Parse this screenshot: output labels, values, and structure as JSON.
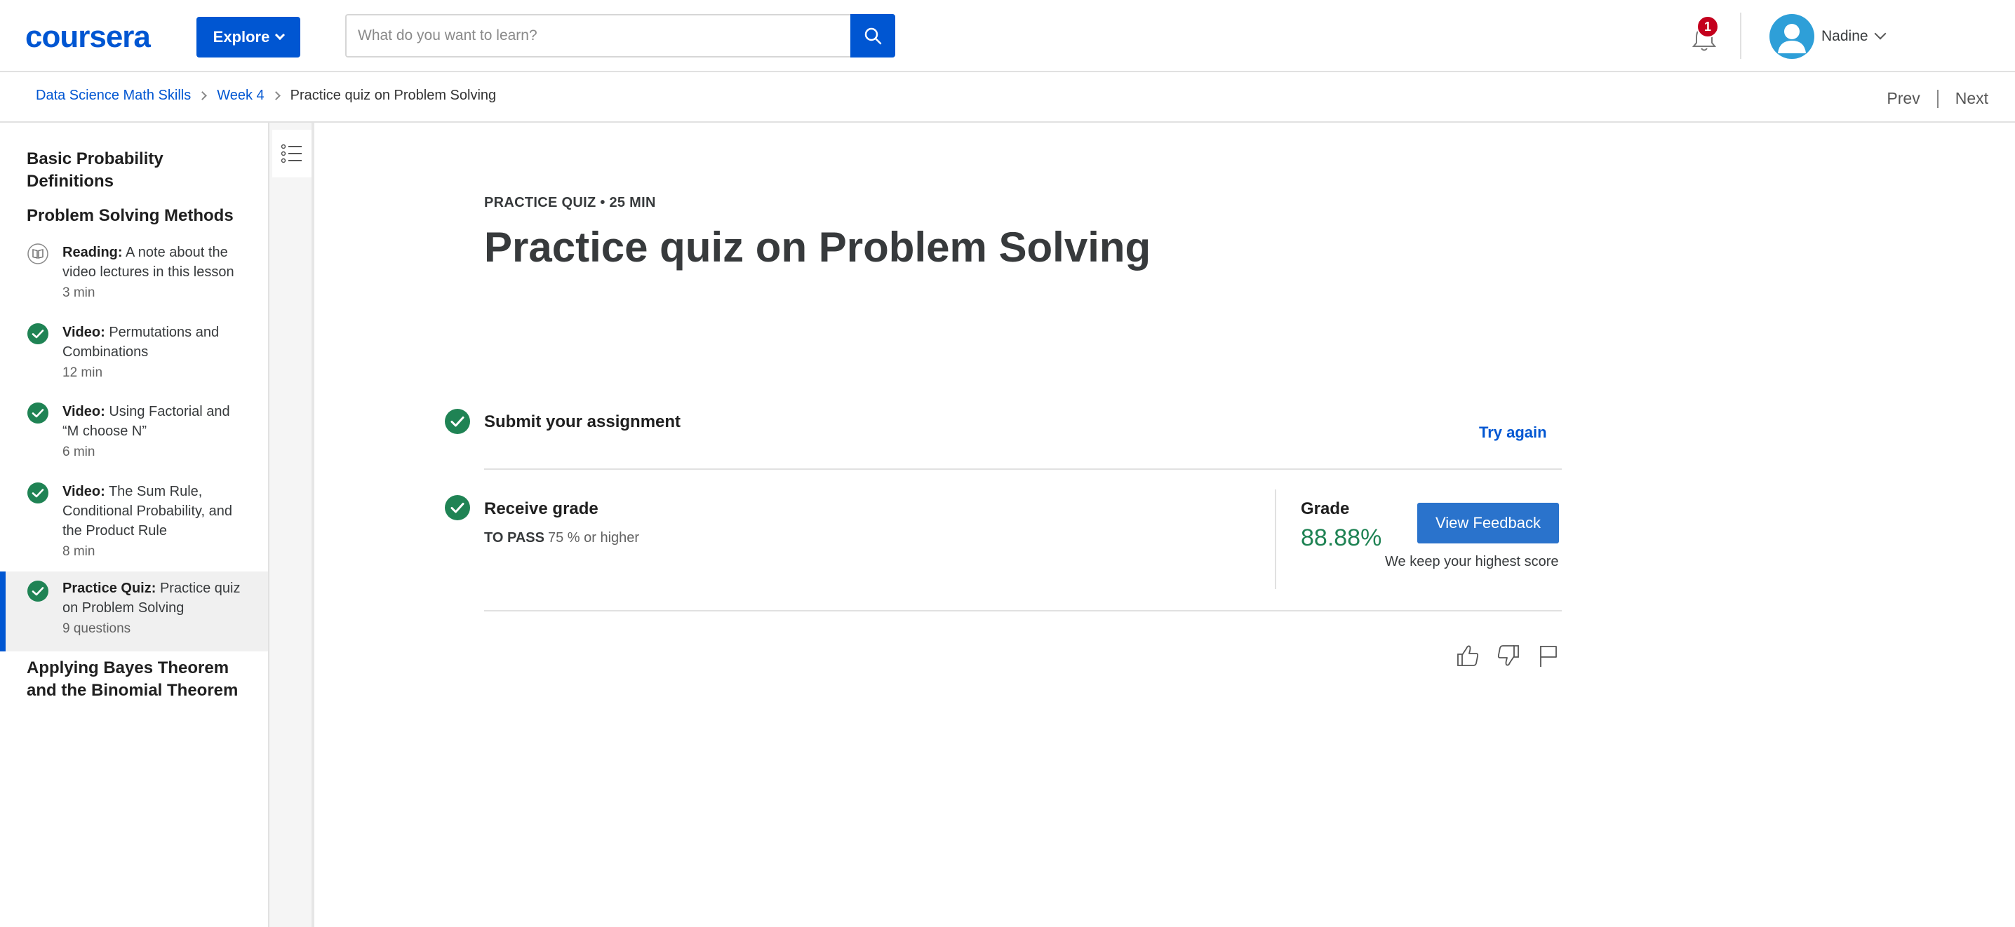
{
  "header": {
    "logo": "coursera",
    "explore_label": "Explore",
    "search_placeholder": "What do you want to learn?",
    "notification_count": "1",
    "user_name": "Nadine"
  },
  "breadcrumb": {
    "items": [
      "Data Science Math Skills",
      "Week 4"
    ],
    "current": "Practice quiz on Problem Solving",
    "prev": "Prev",
    "next": "Next"
  },
  "sidebar": {
    "module_1": "Basic Probability Definitions",
    "module_2": "Problem Solving Methods",
    "items": [
      {
        "type": "Reading:",
        "title": "A note about the video lectures in this lesson",
        "meta": "3 min",
        "status": "reading"
      },
      {
        "type": "Video:",
        "title": "Permutations and Combinations",
        "meta": "12 min",
        "status": "completed"
      },
      {
        "type": "Video:",
        "title": "Using Factorial and “M choose N”",
        "meta": "6 min",
        "status": "completed"
      },
      {
        "type": "Video:",
        "title": "The Sum Rule, Conditional Probability, and the Product Rule",
        "meta": "8 min",
        "status": "completed"
      },
      {
        "type": "Practice Quiz:",
        "title": "Practice quiz on Problem Solving",
        "meta": "9 questions",
        "status": "completed"
      }
    ],
    "module_3": "Applying Bayes Theorem and the Binomial Theorem"
  },
  "main": {
    "kicker": "PRACTICE QUIZ • 25 MIN",
    "title": "Practice quiz on Problem Solving",
    "submit": {
      "title": "Submit your assignment",
      "action": "Try again"
    },
    "receive": {
      "title": "Receive grade",
      "pass_label": "TO PASS",
      "pass_value": "75 % or higher",
      "grade_label": "Grade",
      "grade_value": "88.88%",
      "feedback_button": "View Feedback",
      "note": "We keep your highest score"
    }
  },
  "colors": {
    "brand": "#0056d2",
    "success": "#1f8354",
    "badge": "#c4001d"
  }
}
